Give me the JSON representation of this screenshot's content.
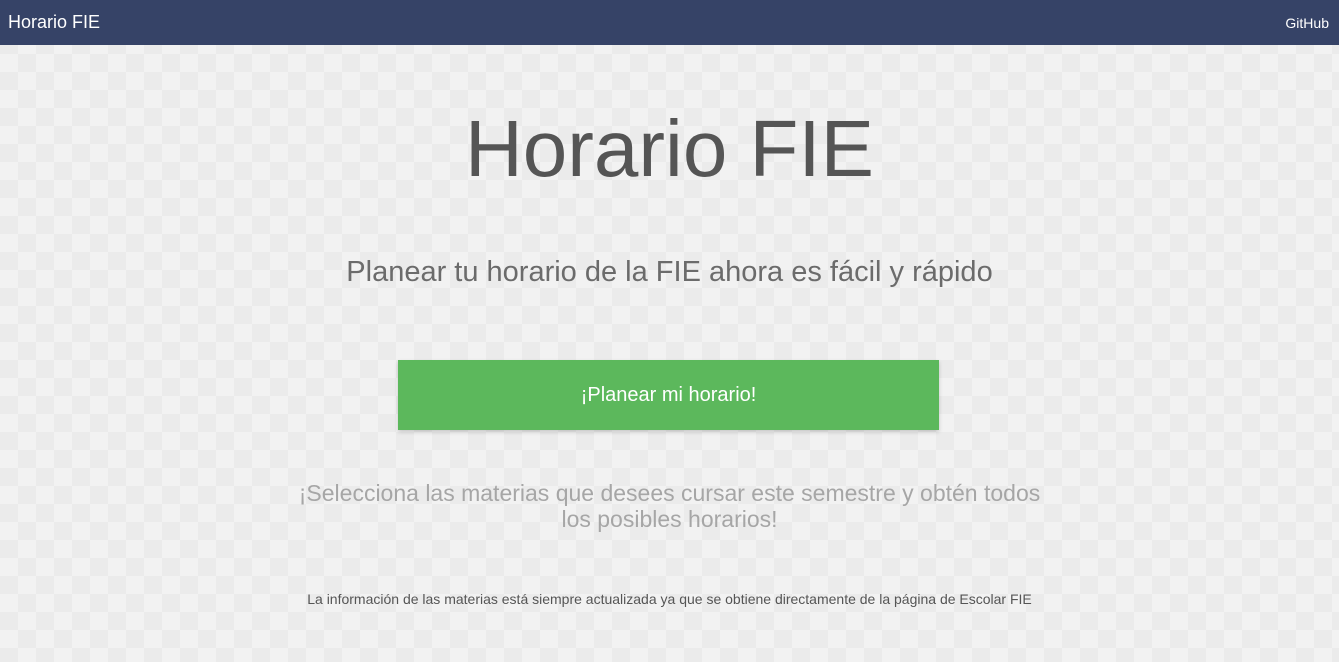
{
  "navbar": {
    "brand": "Horario FIE",
    "github_link": "GitHub",
    "background_color": "#364367"
  },
  "hero": {
    "title": "Horario FIE",
    "subtitle": "Planear tu horario de la FIE ahora es fácil y rápido",
    "cta_label": "¡Planear mi horario!",
    "cta_color": "#5cb85c",
    "description": "¡Selecciona las materias que desees cursar este semestre y obtén todos los posibles horarios!",
    "footnote": "La información de las materias está siempre actualizada ya que se obtiene directamente de la página de Escolar FIE"
  }
}
